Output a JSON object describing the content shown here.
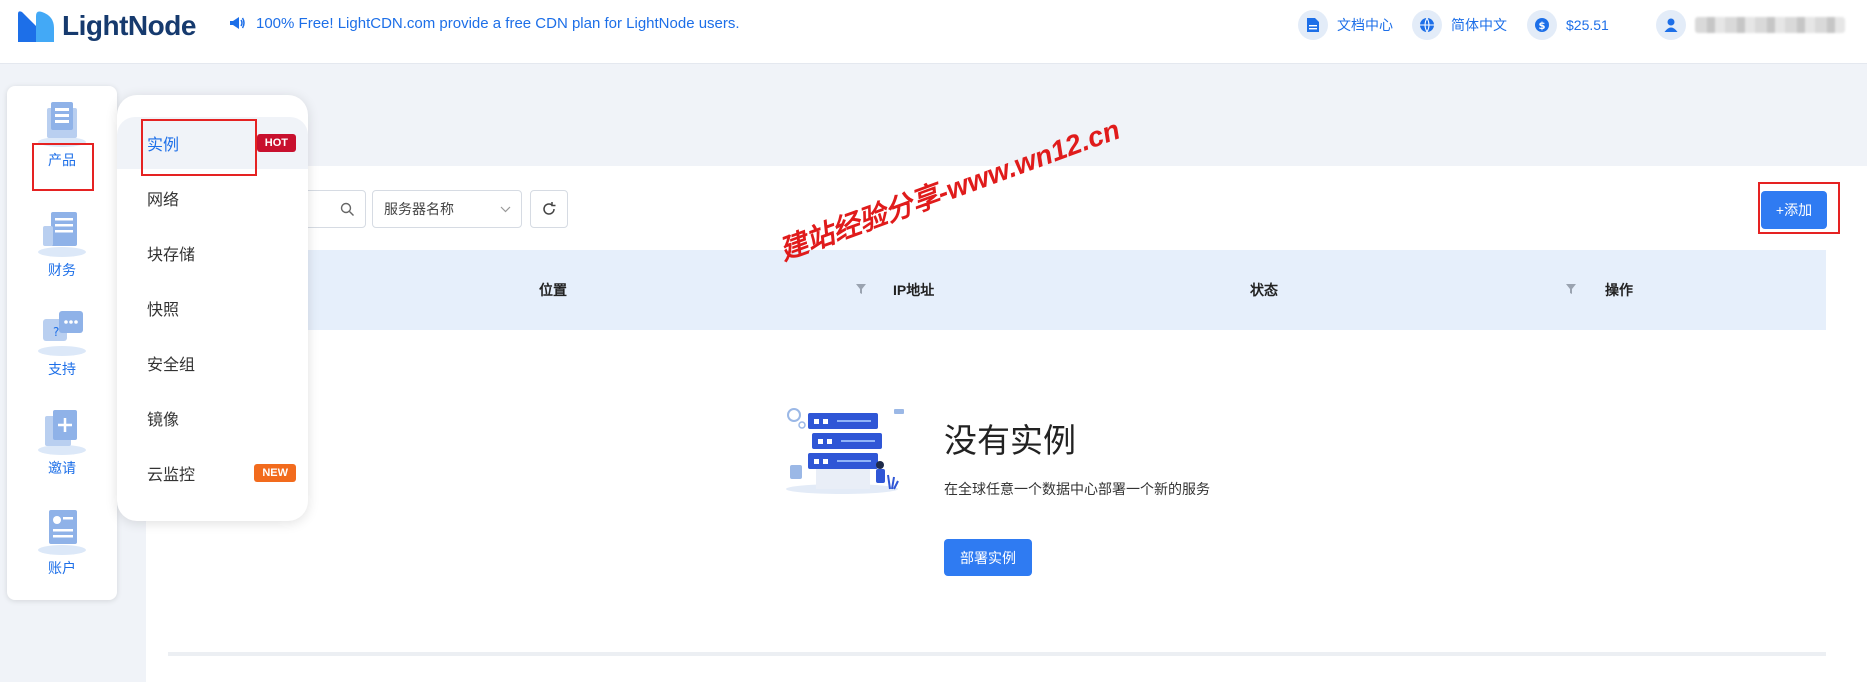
{
  "brand": {
    "name": "LightNode"
  },
  "announcement": "100% Free! LightCDN.com provide a free CDN plan for LightNode users.",
  "header": {
    "docs_label": "文档中心",
    "language_label": "简体中文",
    "balance": "$25.51"
  },
  "rail": {
    "items": [
      {
        "label": "产品",
        "icon": "server-stack-icon"
      },
      {
        "label": "财务",
        "icon": "finance-icon"
      },
      {
        "label": "支持",
        "icon": "support-chat-icon"
      },
      {
        "label": "邀请",
        "icon": "invite-icon"
      },
      {
        "label": "账户",
        "icon": "account-icon"
      }
    ]
  },
  "submenu": {
    "items": [
      {
        "label": "实例",
        "badge": "HOT"
      },
      {
        "label": "网络",
        "badge": ""
      },
      {
        "label": "块存储",
        "badge": ""
      },
      {
        "label": "快照",
        "badge": ""
      },
      {
        "label": "安全组",
        "badge": ""
      },
      {
        "label": "镜像",
        "badge": ""
      },
      {
        "label": "云监控",
        "badge": "NEW"
      }
    ]
  },
  "toolbar": {
    "select_value": "服务器名称",
    "add_label": "+添加"
  },
  "table": {
    "columns": [
      "位置",
      "IP地址",
      "状态",
      "操作"
    ]
  },
  "empty": {
    "title": "没有实例",
    "description": "在全球任意一个数据中心部署一个新的服务",
    "deploy_label": "部署实例"
  },
  "watermark": "建站经验分享-www.wn12.cn",
  "colors": {
    "accent": "#2f7bf2",
    "hot": "#c8102e",
    "new": "#f26b1d",
    "highlight_box": "#e52222"
  }
}
